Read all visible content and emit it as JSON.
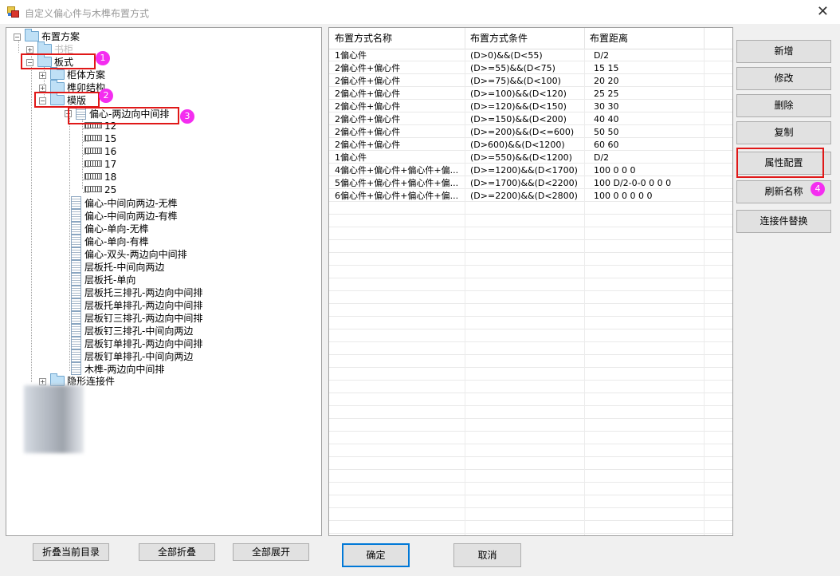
{
  "window": {
    "title": "自定义偏心件与木榫布置方式",
    "close_glyph": "✕"
  },
  "tree": {
    "root": "布置方案",
    "n1": "书柜",
    "n2": "板式",
    "n3": "柜体方案",
    "n4": "榫卯结构",
    "n5": "模版",
    "n6": "偏心-两边向中间排",
    "sizes": [
      "12",
      "15",
      "16",
      "17",
      "18",
      "25"
    ],
    "templates": [
      "偏心-中间向两边-无榫",
      "偏心-中间向两边-有榫",
      "偏心-单向-无榫",
      "偏心-单向-有榫",
      "偏心-双头-两边向中间排",
      "层板托-中间向两边",
      "层板托-单向",
      "层板托三排孔-两边向中间排",
      "层板托单排孔-两边向中间排",
      "层板钉三排孔-两边向中间排",
      "层板钉三排孔-中间向两边",
      "层板钉单排孔-两边向中间排",
      "层板钉单排孔-中间向两边",
      "木榫-两边向中间排"
    ],
    "n7": "隐形连接件"
  },
  "annotations": [
    "1",
    "2",
    "3",
    "4"
  ],
  "grid": {
    "headers": [
      "布置方式名称",
      "布置方式条件",
      "布置距离"
    ],
    "rows": [
      [
        "1偏心件",
        "(D>0)&&(D<55)",
        "D/2"
      ],
      [
        "2偏心件+偏心件",
        "(D>=55)&&(D<75)",
        "15 15"
      ],
      [
        "2偏心件+偏心件",
        "(D>=75)&&(D<100)",
        "20 20"
      ],
      [
        "2偏心件+偏心件",
        "(D>=100)&&(D<120)",
        "25 25"
      ],
      [
        "2偏心件+偏心件",
        "(D>=120)&&(D<150)",
        "30 30"
      ],
      [
        "2偏心件+偏心件",
        "(D>=150)&&(D<200)",
        "40 40"
      ],
      [
        "2偏心件+偏心件",
        "(D>=200)&&(D<=600)",
        "50 50"
      ],
      [
        "2偏心件+偏心件",
        "(D>600)&&(D<1200)",
        "60 60"
      ],
      [
        "1偏心件",
        "(D>=550)&&(D<1200)",
        "D/2"
      ],
      [
        "4偏心件+偏心件+偏心件+偏...",
        "(D>=1200)&&(D<1700)",
        "100 0 0 0"
      ],
      [
        "5偏心件+偏心件+偏心件+偏...",
        "(D>=1700)&&(D<2200)",
        "100 D/2-0-0 0 0 0"
      ],
      [
        "6偏心件+偏心件+偏心件+偏...",
        "(D>=2200)&&(D<2800)",
        "100 0 0 0 0 0"
      ]
    ]
  },
  "buttons": {
    "add": "新增",
    "edit": "修改",
    "delete": "删除",
    "copy": "复制",
    "props": "属性配置",
    "refresh": "刷新名称",
    "replace": "连接件替换",
    "collapse_current": "折叠当前目录",
    "collapse_all": "全部折叠",
    "expand_all": "全部展开",
    "ok": "确定",
    "cancel": "取消"
  },
  "colors": {
    "highlight_box": "#e01818",
    "badge": "#f42df0",
    "primary_border": "#0078d7"
  }
}
